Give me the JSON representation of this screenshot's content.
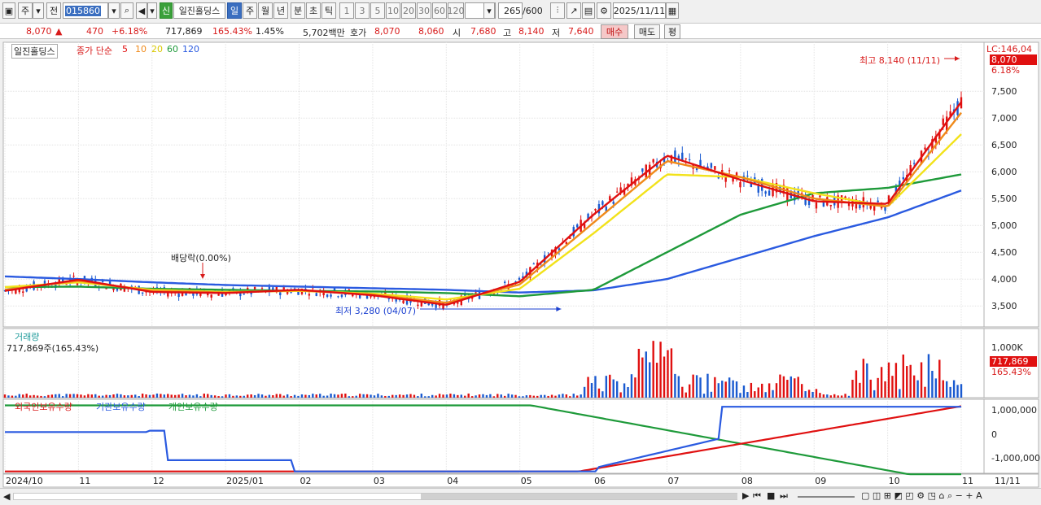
{
  "toolbar": {
    "mode1": "주",
    "mode2": "전",
    "code": "015860",
    "stock_name": "일진홀딩스",
    "badge": "신",
    "periods": [
      "일",
      "주",
      "월",
      "년",
      "분",
      "초",
      "틱"
    ],
    "intervals": [
      "1",
      "3",
      "5",
      "10",
      "20",
      "30",
      "60",
      "120"
    ],
    "count": "265",
    "count_max": "/600",
    "date": "2025/11/11"
  },
  "quote": {
    "price": "8,070",
    "change": "470",
    "change_rate": "+6.18%",
    "volume": "717,869",
    "volume_rate": "165.43%",
    "turnover_rate": "1.45%",
    "amount": "5,702백만",
    "bid_label": "호가",
    "ask": "8,070",
    "bid": "8,060",
    "open_label": "시",
    "open": "7,680",
    "high_label": "고",
    "high": "8,140",
    "low_label": "저",
    "low": "7,640",
    "buy_label": "매수",
    "sell_label": "매도",
    "eval_label": "평"
  },
  "price_panel": {
    "title": "일진홀딩스",
    "ma_label": "종가 단순",
    "ma_periods": [
      "5",
      "10",
      "20",
      "60",
      "120"
    ],
    "lc": "LC:146,04",
    "current_tag": "8,070",
    "current_rate": "6.18%",
    "y_ticks": [
      "7,500",
      "7,000",
      "6,500",
      "6,000",
      "5,500",
      "5,000",
      "4,500",
      "4,000",
      "3,500"
    ],
    "max_annotation": "최고 8,140 (11/11)",
    "min_annotation": "최저 3,280 (04/07)",
    "dividend_annotation": "배당락(0.00%)"
  },
  "volume_panel": {
    "title": "거래량",
    "value": "717,869주(165.43%)",
    "y_tick": "1,000K",
    "current_tag": "717,869",
    "current_rate": "165.43%"
  },
  "holding_panel": {
    "legends": [
      "외국인보유수량",
      "기관보유수량",
      "개인보유수량"
    ],
    "y_ticks": [
      "1,000,000",
      "0",
      "-1,000,000"
    ]
  },
  "x_axis": {
    "labels": [
      "2024/10",
      "11",
      "12",
      "2025/01",
      "02",
      "03",
      "04",
      "05",
      "06",
      "07",
      "08",
      "09",
      "10",
      "11"
    ],
    "right_label": "11/11"
  },
  "colors": {
    "ma5": "#e01010",
    "ma10": "#f08a1a",
    "ma20": "#f2e21a",
    "ma60": "#1e9a3a",
    "ma120": "#2a5ae0",
    "up": "#e01010",
    "down": "#1a5ad0",
    "foreign": "#2a5ae0",
    "institution": "#e01010",
    "individual": "#1e9a3a"
  },
  "chart_data": {
    "type": "line",
    "title": "일진홀딩스",
    "x": [
      "2024/10",
      "11",
      "12",
      "2025/01",
      "02",
      "03",
      "04",
      "05",
      "06",
      "07",
      "08",
      "09",
      "10",
      "11"
    ],
    "series": [
      {
        "name": "5",
        "values": [
          3780,
          3990,
          3760,
          3740,
          3800,
          3700,
          3520,
          3950,
          5200,
          6300,
          5850,
          5450,
          5400,
          7300
        ]
      },
      {
        "name": "10",
        "values": [
          3800,
          3970,
          3780,
          3750,
          3790,
          3710,
          3560,
          3900,
          5050,
          6200,
          5900,
          5500,
          5350,
          7100
        ]
      },
      {
        "name": "20",
        "values": [
          3850,
          3940,
          3800,
          3760,
          3780,
          3730,
          3620,
          3820,
          4850,
          5950,
          5900,
          5600,
          5350,
          6700
        ]
      },
      {
        "name": "60",
        "values": [
          3850,
          3860,
          3820,
          3800,
          3780,
          3770,
          3740,
          3680,
          3800,
          4500,
          5200,
          5600,
          5700,
          5950
        ]
      },
      {
        "name": "120",
        "values": [
          4050,
          4000,
          3940,
          3890,
          3860,
          3830,
          3800,
          3750,
          3790,
          4000,
          4400,
          4800,
          5150,
          5650
        ]
      }
    ],
    "ylim": [
      3200,
      8200
    ],
    "price_max": {
      "date": "11/11",
      "value": 8140
    },
    "price_min": {
      "date": "04/07",
      "value": 3280
    }
  }
}
